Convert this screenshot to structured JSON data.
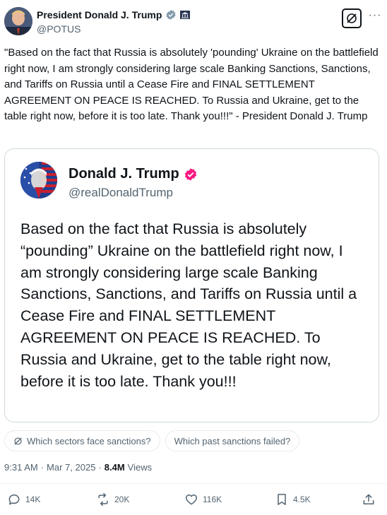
{
  "author": {
    "display_name": "President Donald J. Trump",
    "handle": "@POTUS",
    "verified_badge": "gray-check-icon",
    "affiliation_badge": "government-building-icon"
  },
  "tweet": {
    "text": "\"Based on the fact that Russia is absolutely 'pounding' Ukraine on the battlefield right now, I am strongly considering large scale Banking Sanctions, Sanctions, and Tariffs on Russia until a Cease Fire and FINAL SETTLEMENT AGREEMENT ON PEACE IS REACHED. To Russia and Ukraine, get to the table right now, before it is too late. Thank you!!!\" - President Donald J. Trump"
  },
  "quote": {
    "display_name": "Donald J. Trump",
    "handle": "@realDonaldTrump",
    "text": "Based on the fact that Russia is absolutely “pounding” Ukraine on the battlefield right now, I am strongly considering large scale Banking Sanctions, Sanctions, and Tariffs on Russia until a Cease Fire and FINAL SETTLEMENT AGREEMENT ON PEACE IS REACHED. To Russia and Ukraine, get to the table right now, before it is too late. Thank you!!!"
  },
  "suggestions": [
    {
      "label": "Which sectors face sanctions?",
      "icon": "grok-icon"
    },
    {
      "label": "Which past sanctions failed?"
    }
  ],
  "meta": {
    "time": "9:31 AM",
    "sep1": "·",
    "date": "Mar 7, 2025",
    "sep2": "·",
    "views_count": "8.4M",
    "views_label": "Views"
  },
  "actions": {
    "replies": "14K",
    "reposts": "20K",
    "likes": "116K",
    "bookmarks": "4.5K"
  },
  "colors": {
    "text": "#0f1419",
    "secondary": "#536471",
    "border": "#cfd9de",
    "verified_quote": "#f91880",
    "verified_gray": "#829aab"
  }
}
